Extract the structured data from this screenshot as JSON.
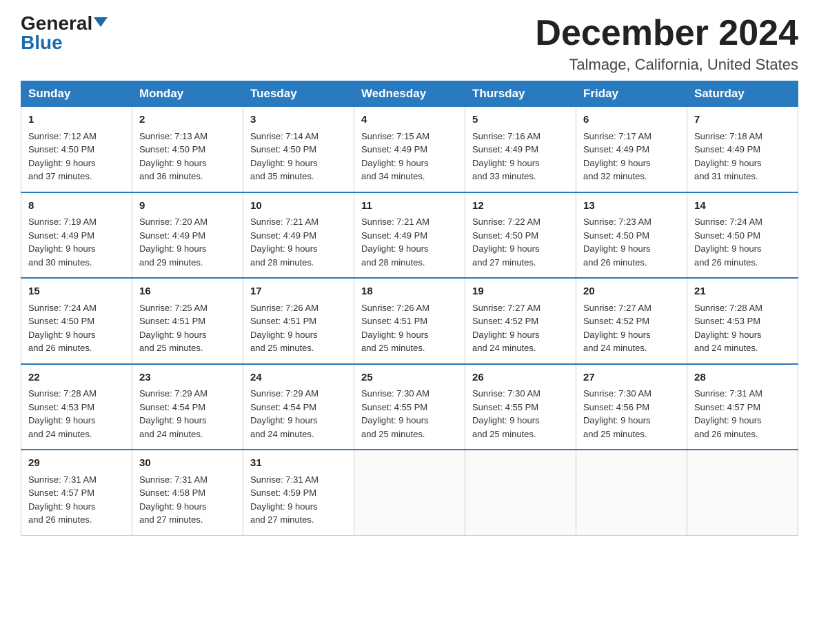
{
  "header": {
    "logo_general": "General",
    "logo_blue": "Blue",
    "month_title": "December 2024",
    "location": "Talmage, California, United States"
  },
  "weekdays": [
    "Sunday",
    "Monday",
    "Tuesday",
    "Wednesday",
    "Thursday",
    "Friday",
    "Saturday"
  ],
  "weeks": [
    [
      {
        "day": "1",
        "sunrise": "7:12 AM",
        "sunset": "4:50 PM",
        "daylight": "9 hours and 37 minutes."
      },
      {
        "day": "2",
        "sunrise": "7:13 AM",
        "sunset": "4:50 PM",
        "daylight": "9 hours and 36 minutes."
      },
      {
        "day": "3",
        "sunrise": "7:14 AM",
        "sunset": "4:50 PM",
        "daylight": "9 hours and 35 minutes."
      },
      {
        "day": "4",
        "sunrise": "7:15 AM",
        "sunset": "4:49 PM",
        "daylight": "9 hours and 34 minutes."
      },
      {
        "day": "5",
        "sunrise": "7:16 AM",
        "sunset": "4:49 PM",
        "daylight": "9 hours and 33 minutes."
      },
      {
        "day": "6",
        "sunrise": "7:17 AM",
        "sunset": "4:49 PM",
        "daylight": "9 hours and 32 minutes."
      },
      {
        "day": "7",
        "sunrise": "7:18 AM",
        "sunset": "4:49 PM",
        "daylight": "9 hours and 31 minutes."
      }
    ],
    [
      {
        "day": "8",
        "sunrise": "7:19 AM",
        "sunset": "4:49 PM",
        "daylight": "9 hours and 30 minutes."
      },
      {
        "day": "9",
        "sunrise": "7:20 AM",
        "sunset": "4:49 PM",
        "daylight": "9 hours and 29 minutes."
      },
      {
        "day": "10",
        "sunrise": "7:21 AM",
        "sunset": "4:49 PM",
        "daylight": "9 hours and 28 minutes."
      },
      {
        "day": "11",
        "sunrise": "7:21 AM",
        "sunset": "4:49 PM",
        "daylight": "9 hours and 28 minutes."
      },
      {
        "day": "12",
        "sunrise": "7:22 AM",
        "sunset": "4:50 PM",
        "daylight": "9 hours and 27 minutes."
      },
      {
        "day": "13",
        "sunrise": "7:23 AM",
        "sunset": "4:50 PM",
        "daylight": "9 hours and 26 minutes."
      },
      {
        "day": "14",
        "sunrise": "7:24 AM",
        "sunset": "4:50 PM",
        "daylight": "9 hours and 26 minutes."
      }
    ],
    [
      {
        "day": "15",
        "sunrise": "7:24 AM",
        "sunset": "4:50 PM",
        "daylight": "9 hours and 26 minutes."
      },
      {
        "day": "16",
        "sunrise": "7:25 AM",
        "sunset": "4:51 PM",
        "daylight": "9 hours and 25 minutes."
      },
      {
        "day": "17",
        "sunrise": "7:26 AM",
        "sunset": "4:51 PM",
        "daylight": "9 hours and 25 minutes."
      },
      {
        "day": "18",
        "sunrise": "7:26 AM",
        "sunset": "4:51 PM",
        "daylight": "9 hours and 25 minutes."
      },
      {
        "day": "19",
        "sunrise": "7:27 AM",
        "sunset": "4:52 PM",
        "daylight": "9 hours and 24 minutes."
      },
      {
        "day": "20",
        "sunrise": "7:27 AM",
        "sunset": "4:52 PM",
        "daylight": "9 hours and 24 minutes."
      },
      {
        "day": "21",
        "sunrise": "7:28 AM",
        "sunset": "4:53 PM",
        "daylight": "9 hours and 24 minutes."
      }
    ],
    [
      {
        "day": "22",
        "sunrise": "7:28 AM",
        "sunset": "4:53 PM",
        "daylight": "9 hours and 24 minutes."
      },
      {
        "day": "23",
        "sunrise": "7:29 AM",
        "sunset": "4:54 PM",
        "daylight": "9 hours and 24 minutes."
      },
      {
        "day": "24",
        "sunrise": "7:29 AM",
        "sunset": "4:54 PM",
        "daylight": "9 hours and 24 minutes."
      },
      {
        "day": "25",
        "sunrise": "7:30 AM",
        "sunset": "4:55 PM",
        "daylight": "9 hours and 25 minutes."
      },
      {
        "day": "26",
        "sunrise": "7:30 AM",
        "sunset": "4:55 PM",
        "daylight": "9 hours and 25 minutes."
      },
      {
        "day": "27",
        "sunrise": "7:30 AM",
        "sunset": "4:56 PM",
        "daylight": "9 hours and 25 minutes."
      },
      {
        "day": "28",
        "sunrise": "7:31 AM",
        "sunset": "4:57 PM",
        "daylight": "9 hours and 26 minutes."
      }
    ],
    [
      {
        "day": "29",
        "sunrise": "7:31 AM",
        "sunset": "4:57 PM",
        "daylight": "9 hours and 26 minutes."
      },
      {
        "day": "30",
        "sunrise": "7:31 AM",
        "sunset": "4:58 PM",
        "daylight": "9 hours and 27 minutes."
      },
      {
        "day": "31",
        "sunrise": "7:31 AM",
        "sunset": "4:59 PM",
        "daylight": "9 hours and 27 minutes."
      },
      null,
      null,
      null,
      null
    ]
  ],
  "labels": {
    "sunrise": "Sunrise:",
    "sunset": "Sunset:",
    "daylight": "Daylight:"
  }
}
